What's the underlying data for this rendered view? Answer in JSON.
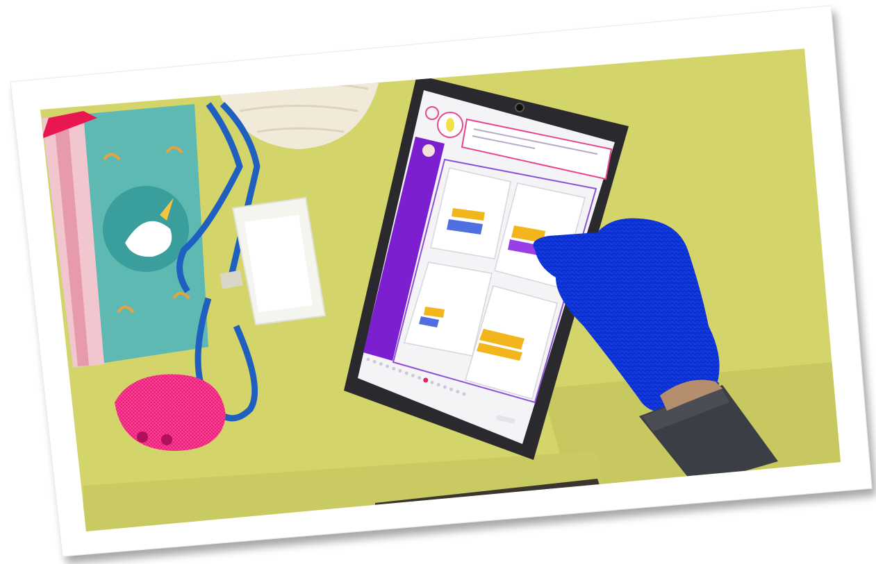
{
  "scene": {
    "description_alt": "",
    "colors": {
      "page_background": "#ffffff",
      "photo_frame": "#ffffff",
      "table": "#d3d56a",
      "table_shadow": "#b9bb55",
      "tablet_bezel": "#2a2a2e",
      "screen": "#f4f3f6",
      "sidebar_purple": "#7b1fd0",
      "accent_pink": "#e6468e",
      "block_yellow": "#f2b51b",
      "block_blue": "#4f6fe0",
      "block_purple": "#9a3fe6",
      "glove_blue": "#0b2fd0",
      "pouch_teal": "#5fb9b3",
      "lanyard_blue": "#1f5fc0",
      "fuzzy_pink": "#e81c78",
      "beanie_cream": "#f1ead9"
    },
    "tablet": {
      "instruction_text": "",
      "progress_dots_total": 16,
      "progress_current_index": 9,
      "cards": [
        {
          "id": "card-1",
          "blocks": [
            "yellow",
            "blue"
          ]
        },
        {
          "id": "card-2",
          "blocks": [
            "yellow",
            "purple"
          ]
        },
        {
          "id": "card-3",
          "blocks": [
            "yellow",
            "blue"
          ]
        },
        {
          "id": "card-4",
          "blocks": [
            "yellow",
            "yellow"
          ]
        }
      ]
    },
    "icons": [
      "avatar-icon",
      "mascot-icon",
      "home-icon",
      "camera-icon"
    ]
  }
}
